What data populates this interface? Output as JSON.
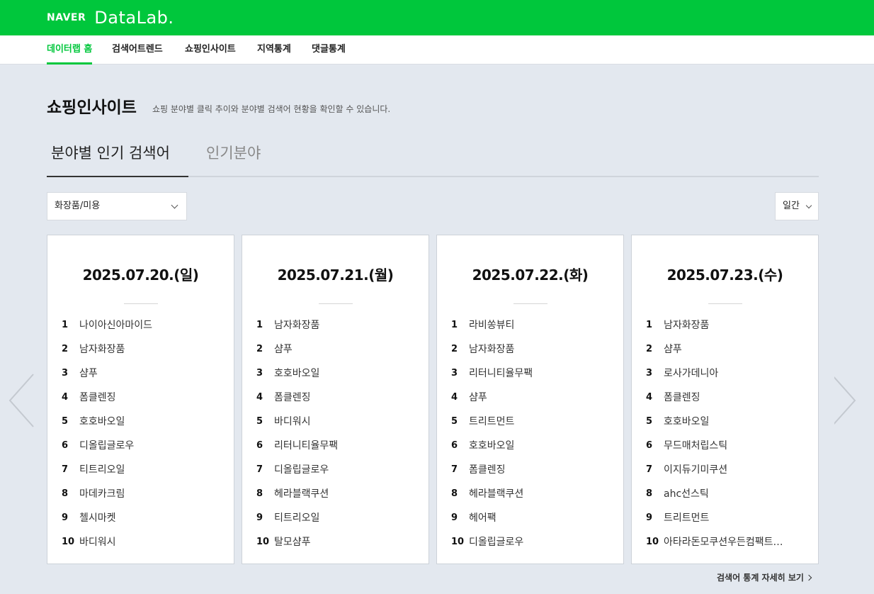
{
  "header": {
    "logo_naver": "NAVER",
    "logo_datalab": "DataLab."
  },
  "nav": {
    "items": [
      {
        "label": "데이터랩 홈",
        "active": true
      },
      {
        "label": "검색어트렌드",
        "active": false
      },
      {
        "label": "쇼핑인사이트",
        "active": false
      },
      {
        "label": "지역통계",
        "active": false
      },
      {
        "label": "댓글통계",
        "active": false
      }
    ]
  },
  "page": {
    "title": "쇼핑인사이트",
    "description": "쇼핑 분야별 클릭 추이와 분야별 검색어 현황을 확인할 수 있습니다."
  },
  "tabs": [
    {
      "label": "분야별 인기 검색어",
      "active": true
    },
    {
      "label": "인기분야",
      "active": false
    }
  ],
  "filters": {
    "category": "화장품/미용",
    "period": "일간"
  },
  "cards": [
    {
      "date": "2025.07.20.(일)",
      "items": [
        "나이아신아마이드",
        "남자화장품",
        "샴푸",
        "폼클렌징",
        "호호바오일",
        "디올립글로우",
        "티트리오일",
        "마데카크림",
        "첼시마켓",
        "바디워시"
      ]
    },
    {
      "date": "2025.07.21.(월)",
      "items": [
        "남자화장품",
        "샴푸",
        "호호바오일",
        "폼클렌징",
        "바디워시",
        "리터니티율무팩",
        "디올립글로우",
        "헤라블랙쿠션",
        "티트리오일",
        "탈모샴푸"
      ]
    },
    {
      "date": "2025.07.22.(화)",
      "items": [
        "라비쏭뷰티",
        "남자화장품",
        "리터니티율무팩",
        "샴푸",
        "트리트먼트",
        "호호바오일",
        "폼클렌징",
        "헤라블랙쿠션",
        "헤어팩",
        "디올립글로우"
      ]
    },
    {
      "date": "2025.07.23.(수)",
      "items": [
        "남자화장품",
        "샴푸",
        "로사가데니아",
        "폼클렌징",
        "호호바오일",
        "무드매처립스틱",
        "이지듀기미쿠션",
        "ahc선스틱",
        "트리트먼트",
        "아타라돈모쿠션우든컴팩트…"
      ]
    }
  ],
  "footer": {
    "more_label": "검색어 통계 자세히 보기"
  }
}
